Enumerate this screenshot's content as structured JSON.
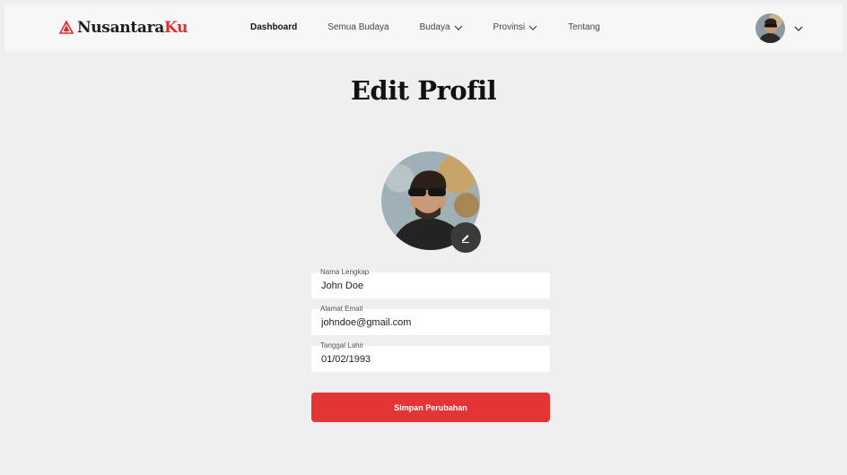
{
  "brand": {
    "name_main": "Nusantara",
    "name_accent": "Ku",
    "accent_color": "#e02f2f"
  },
  "nav": {
    "items": [
      {
        "label": "Dashboard",
        "active": true,
        "dropdown": false
      },
      {
        "label": "Semua Budaya",
        "active": false,
        "dropdown": false
      },
      {
        "label": "Budaya",
        "active": false,
        "dropdown": true
      },
      {
        "label": "Provinsi",
        "active": false,
        "dropdown": true
      },
      {
        "label": "Tentang",
        "active": false,
        "dropdown": false
      }
    ]
  },
  "user_menu": {
    "avatar_icon": "user-avatar",
    "dropdown_icon": "chevron-down-icon"
  },
  "page": {
    "title": "Edit Profil"
  },
  "profile": {
    "edit_photo_icon": "pencil-icon",
    "fields": {
      "name": {
        "label": "Nama Lengkap",
        "value": "John Doe"
      },
      "email": {
        "label": "Alamat Email",
        "value": "johndoe@gmail.com"
      },
      "dob": {
        "label": "Tanggal Lahir",
        "value": "01/02/1993"
      }
    },
    "save_label": "Simpan Perubahan",
    "save_color": "#e33535"
  }
}
